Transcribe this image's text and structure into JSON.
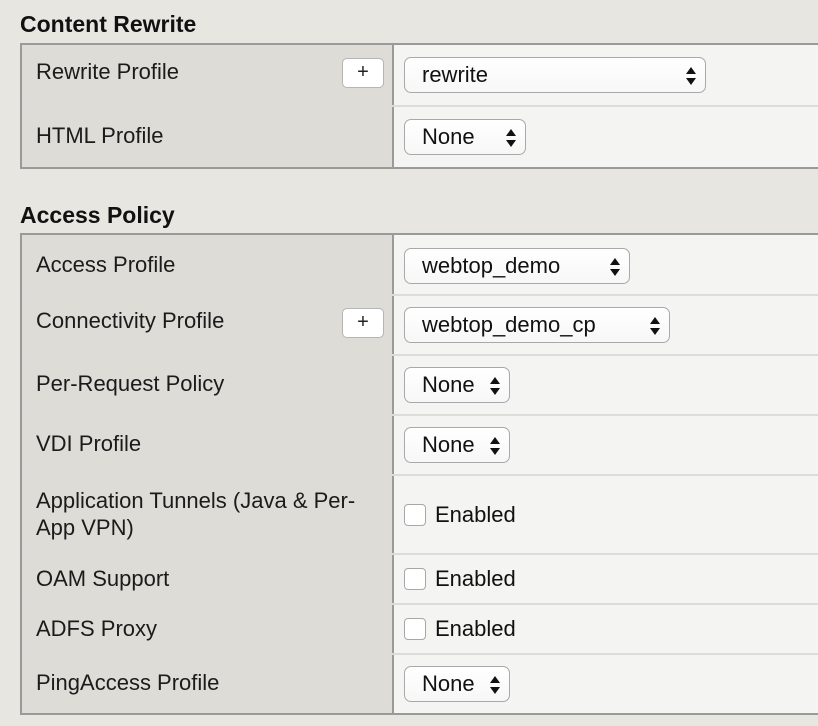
{
  "content_rewrite": {
    "title": "Content Rewrite",
    "rewrite_profile": {
      "label": "Rewrite Profile",
      "add_label": "+",
      "value": "rewrite"
    },
    "html_profile": {
      "label": "HTML Profile",
      "value": "None"
    }
  },
  "access_policy": {
    "title": "Access Policy",
    "access_profile": {
      "label": "Access Profile",
      "value": "webtop_demo"
    },
    "connectivity_profile": {
      "label": "Connectivity Profile",
      "add_label": "+",
      "value": "webtop_demo_cp"
    },
    "per_request_policy": {
      "label": "Per-Request Policy",
      "value": "None"
    },
    "vdi_profile": {
      "label": "VDI Profile",
      "value": "None"
    },
    "application_tunnels": {
      "label": "Application Tunnels (Java & Per-App VPN)",
      "checkbox_label": "Enabled",
      "checked": false
    },
    "oam_support": {
      "label": "OAM Support",
      "checkbox_label": "Enabled",
      "checked": false
    },
    "adfs_proxy": {
      "label": "ADFS Proxy",
      "checkbox_label": "Enabled",
      "checked": false
    },
    "pingaccess_profile": {
      "label": "PingAccess Profile",
      "value": "None"
    }
  }
}
